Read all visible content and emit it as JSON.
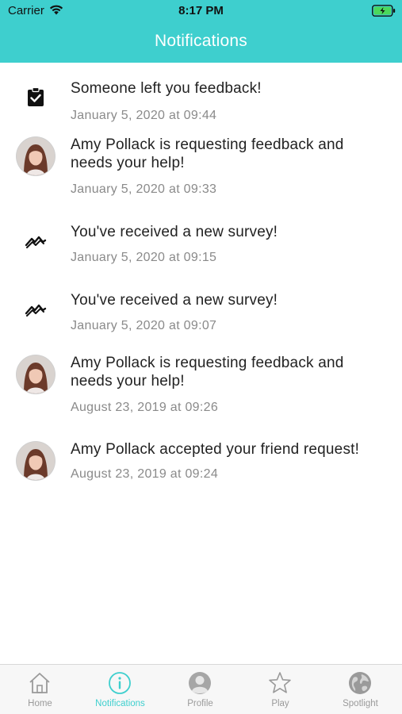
{
  "status_bar": {
    "carrier": "Carrier",
    "time": "8:17 PM"
  },
  "header": {
    "title": "Notifications"
  },
  "notifications": [
    {
      "icon": "clipboard-check-icon",
      "message": "Someone left you feedback!",
      "time": "January 5, 2020 at 09:44"
    },
    {
      "icon": "avatar",
      "message": "Amy Pollack is requesting feedback and needs your help!",
      "time": "January 5, 2020 at 09:33"
    },
    {
      "icon": "survey-trend-icon",
      "message": "You've received a new survey!",
      "time": "January 5, 2020 at 09:15"
    },
    {
      "icon": "survey-trend-icon",
      "message": "You've received a new survey!",
      "time": "January 5, 2020 at 09:07"
    },
    {
      "icon": "avatar",
      "message": "Amy Pollack is requesting feedback and needs your help!",
      "time": "August 23, 2019 at 09:26"
    },
    {
      "icon": "avatar",
      "message": "Amy Pollack accepted your friend request!",
      "time": "August 23, 2019 at 09:24"
    }
  ],
  "tabbar": {
    "active": "Notifications",
    "accent": "#3ecfce",
    "tabs": [
      {
        "label": "Home",
        "icon": "home-icon"
      },
      {
        "label": "Notifications",
        "icon": "info-icon"
      },
      {
        "label": "Profile",
        "icon": "profile-icon"
      },
      {
        "label": "Play",
        "icon": "star-icon"
      },
      {
        "label": "Spotlight",
        "icon": "globe-icon"
      }
    ]
  }
}
